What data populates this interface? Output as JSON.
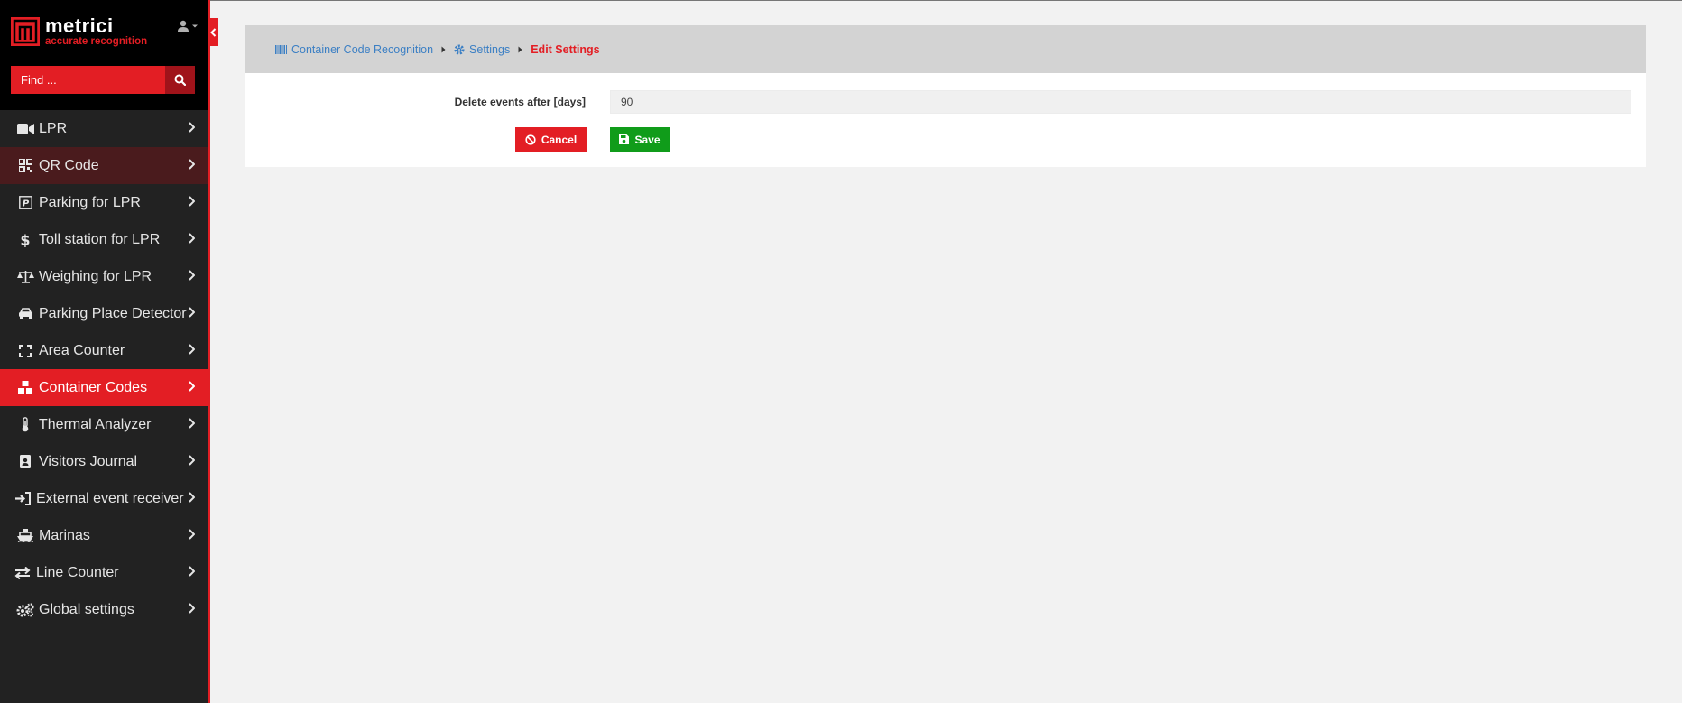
{
  "brand": {
    "name": "metrici",
    "tagline": "accurate recognition",
    "accent": "#e31e24"
  },
  "search": {
    "placeholder": "Find ..."
  },
  "nav": {
    "items": [
      {
        "label": "LPR",
        "icon": "video-camera-icon"
      },
      {
        "label": "QR Code",
        "icon": "qr-code-icon"
      },
      {
        "label": "Parking for LPR",
        "icon": "parking-icon"
      },
      {
        "label": "Toll station for LPR",
        "icon": "dollar-icon"
      },
      {
        "label": "Weighing for LPR",
        "icon": "scale-icon"
      },
      {
        "label": "Parking Place Detector",
        "icon": "car-icon"
      },
      {
        "label": "Area Counter",
        "icon": "expand-icon"
      },
      {
        "label": "Container Codes",
        "icon": "boxes-icon"
      },
      {
        "label": "Thermal Analyzer",
        "icon": "thermometer-icon"
      },
      {
        "label": "Visitors Journal",
        "icon": "id-badge-icon"
      },
      {
        "label": "External event receiver",
        "icon": "sign-in-icon"
      },
      {
        "label": "Marinas",
        "icon": "ship-icon"
      },
      {
        "label": "Line Counter",
        "icon": "exchange-icon"
      },
      {
        "label": "Global settings",
        "icon": "gears-icon"
      }
    ]
  },
  "breadcrumb": {
    "items": [
      {
        "label": "Container Code Recognition",
        "icon": "barcode-icon"
      },
      {
        "label": "Settings",
        "icon": "gear-icon"
      },
      {
        "label": "Edit Settings"
      }
    ]
  },
  "form": {
    "delete_label": "Delete events after [days]",
    "delete_value": "90",
    "cancel_label": "Cancel",
    "save_label": "Save"
  }
}
